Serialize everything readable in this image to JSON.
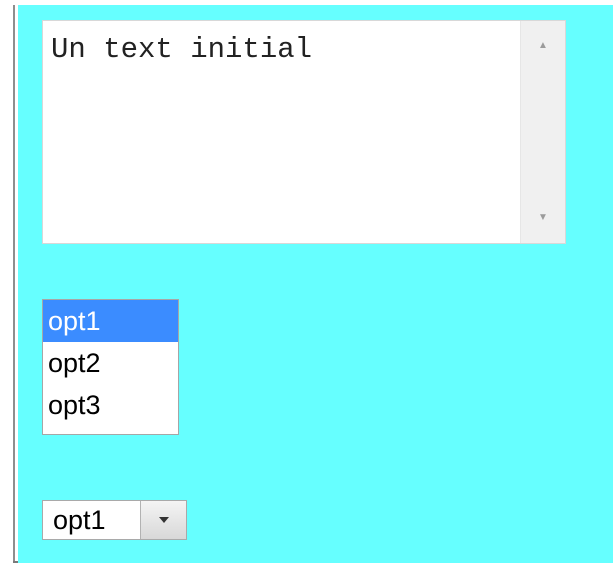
{
  "textarea": {
    "value": "Un text initial"
  },
  "listbox": {
    "options": [
      "opt1",
      "opt2",
      "opt3"
    ],
    "selected": "opt1"
  },
  "dropdown": {
    "value": "opt1"
  },
  "colors": {
    "background": "#66ffff",
    "selection": "#3b8cff"
  }
}
